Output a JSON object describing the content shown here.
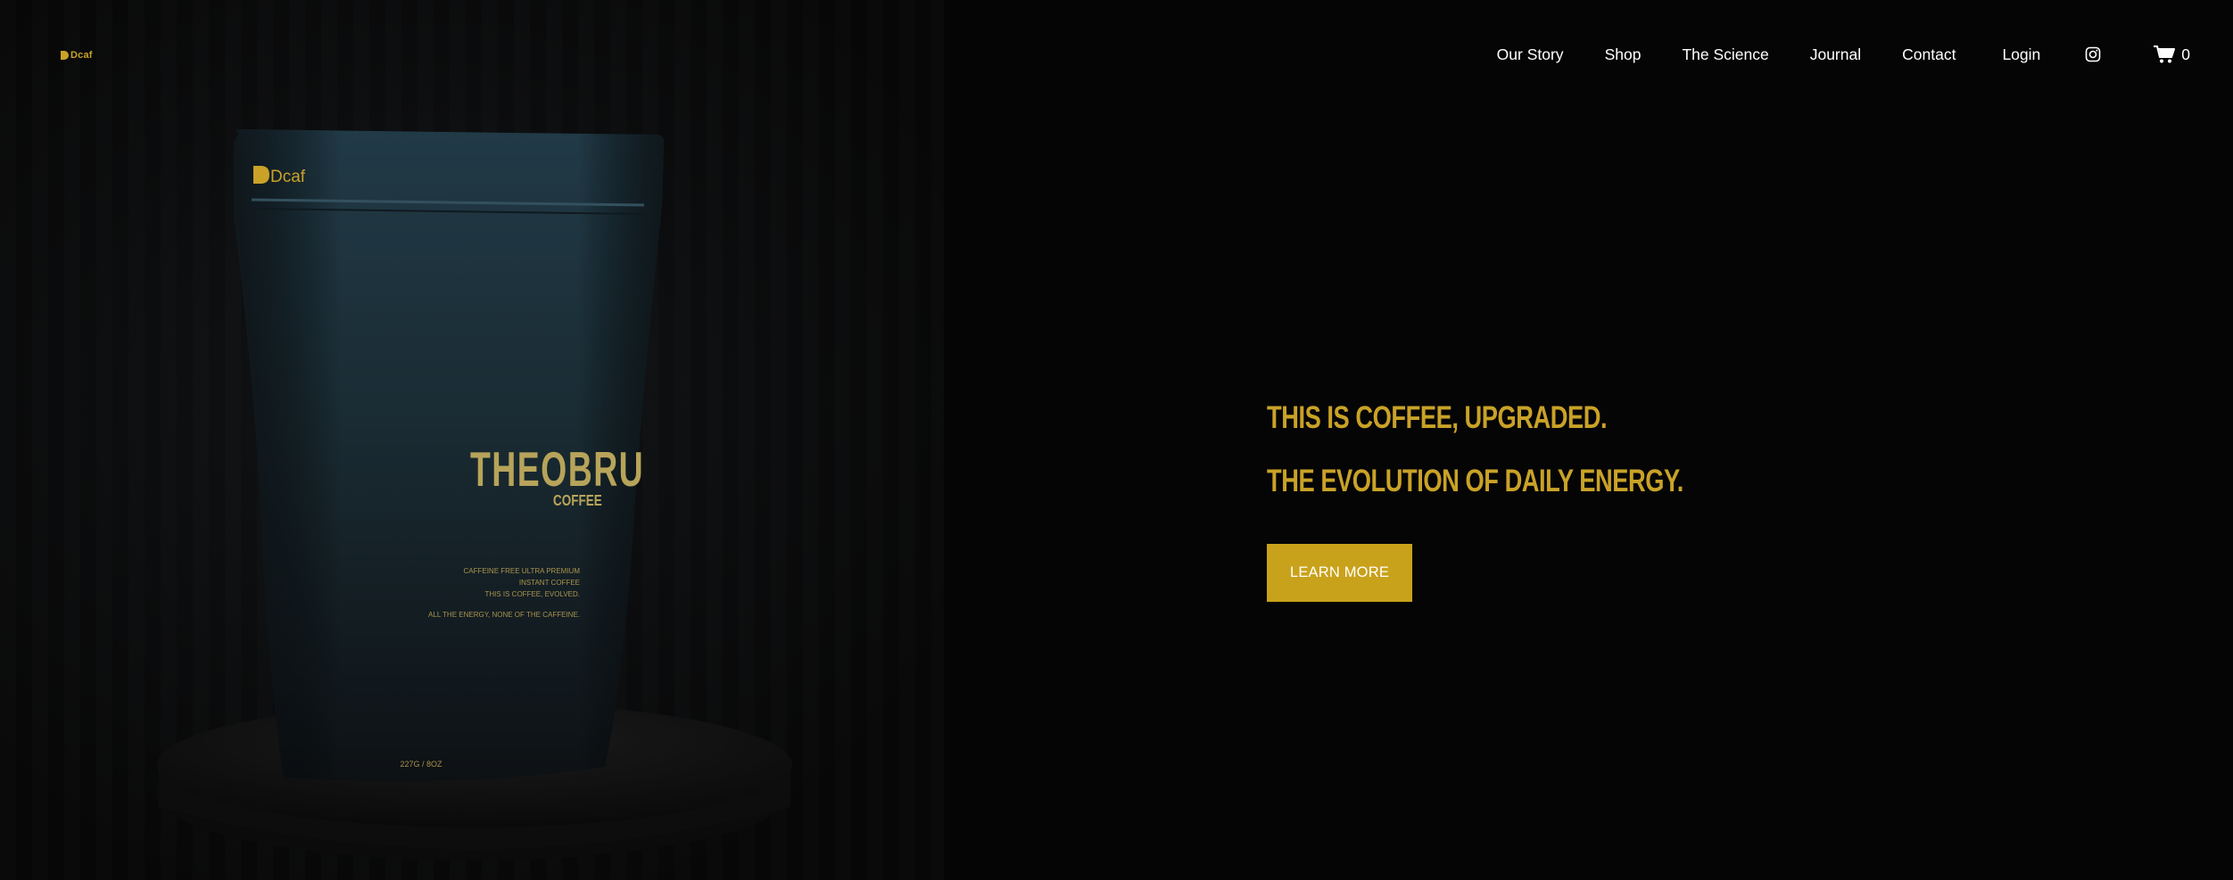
{
  "brand": {
    "name": "Dcaf",
    "accent_color": "#c9a227"
  },
  "nav": {
    "items": [
      {
        "label": "Our Story"
      },
      {
        "label": "Shop"
      },
      {
        "label": "The Science"
      },
      {
        "label": "Journal"
      },
      {
        "label": "Contact"
      }
    ],
    "login": "Login",
    "instagram_icon": "instagram-icon",
    "cart_icon": "cart-icon",
    "cart_count": "0"
  },
  "hero": {
    "product": {
      "bag_logo": "Dcaf",
      "product_name": "THEOBRU",
      "product_sub": "COFFEE",
      "bag_lines": [
        "CAFFEINE FREE ULTRA PREMIUM",
        "INSTANT COFFEE",
        "THIS IS COFFEE, EVOLVED.",
        "ALL THE ENERGY, NONE OF THE CAFFEINE."
      ],
      "weight": "227G / 8OZ"
    },
    "headline_1": "THIS IS COFFEE, UPGRADED.",
    "headline_2": "THE EVOLUTION OF DAILY ENERGY.",
    "cta_label": "LEARN MORE"
  }
}
